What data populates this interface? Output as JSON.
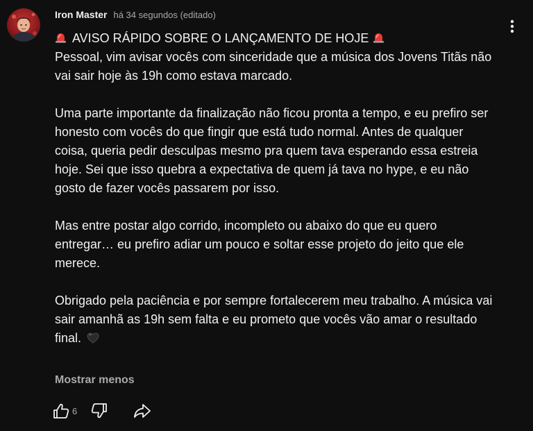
{
  "comment": {
    "author": "Iron Master",
    "time": "há 34 segundos (editado)",
    "avatar_icon": "user-avatar",
    "heading": "AVISO RÁPIDO SOBRE O LANÇAMENTO DE HOJE",
    "heading_icon": "siren-emoji",
    "paragraphs": [
      "Pessoal, vim avisar vocês com sinceridade que a música dos Jovens Titãs não vai sair hoje às 19h como estava marcado.",
      "Uma parte importante da finalização não ficou pronta a tempo, e eu prefiro ser honesto com vocês do que fingir que está tudo normal. Antes de qualquer coisa, queria pedir desculpas mesmo pra quem tava esperando essa estreia hoje. Sei que isso quebra a expectativa de quem já tava no hype, e eu não gosto de fazer vocês passarem por isso.",
      "Mas entre postar algo corrido, incompleto ou abaixo do que eu quero entregar… eu prefiro adiar um pouco e soltar esse projeto do jeito que ele merece.",
      "Obrigado pela paciência e por sempre fortalecerem meu trabalho. A música vai sair amanhã as 19h sem falta e eu prometo que vocês vão amar o resultado final."
    ],
    "end_emoji": "black-heart-emoji",
    "show_less_label": "Mostrar menos",
    "like_count": "6"
  },
  "icons": {
    "menu": "more-vertical-icon",
    "like": "thumbs-up-icon",
    "dislike": "thumbs-down-icon",
    "share": "share-icon"
  },
  "colors": {
    "background": "#0f0f0f",
    "text": "#f1f1f1",
    "secondary_text": "#aaaaaa"
  }
}
